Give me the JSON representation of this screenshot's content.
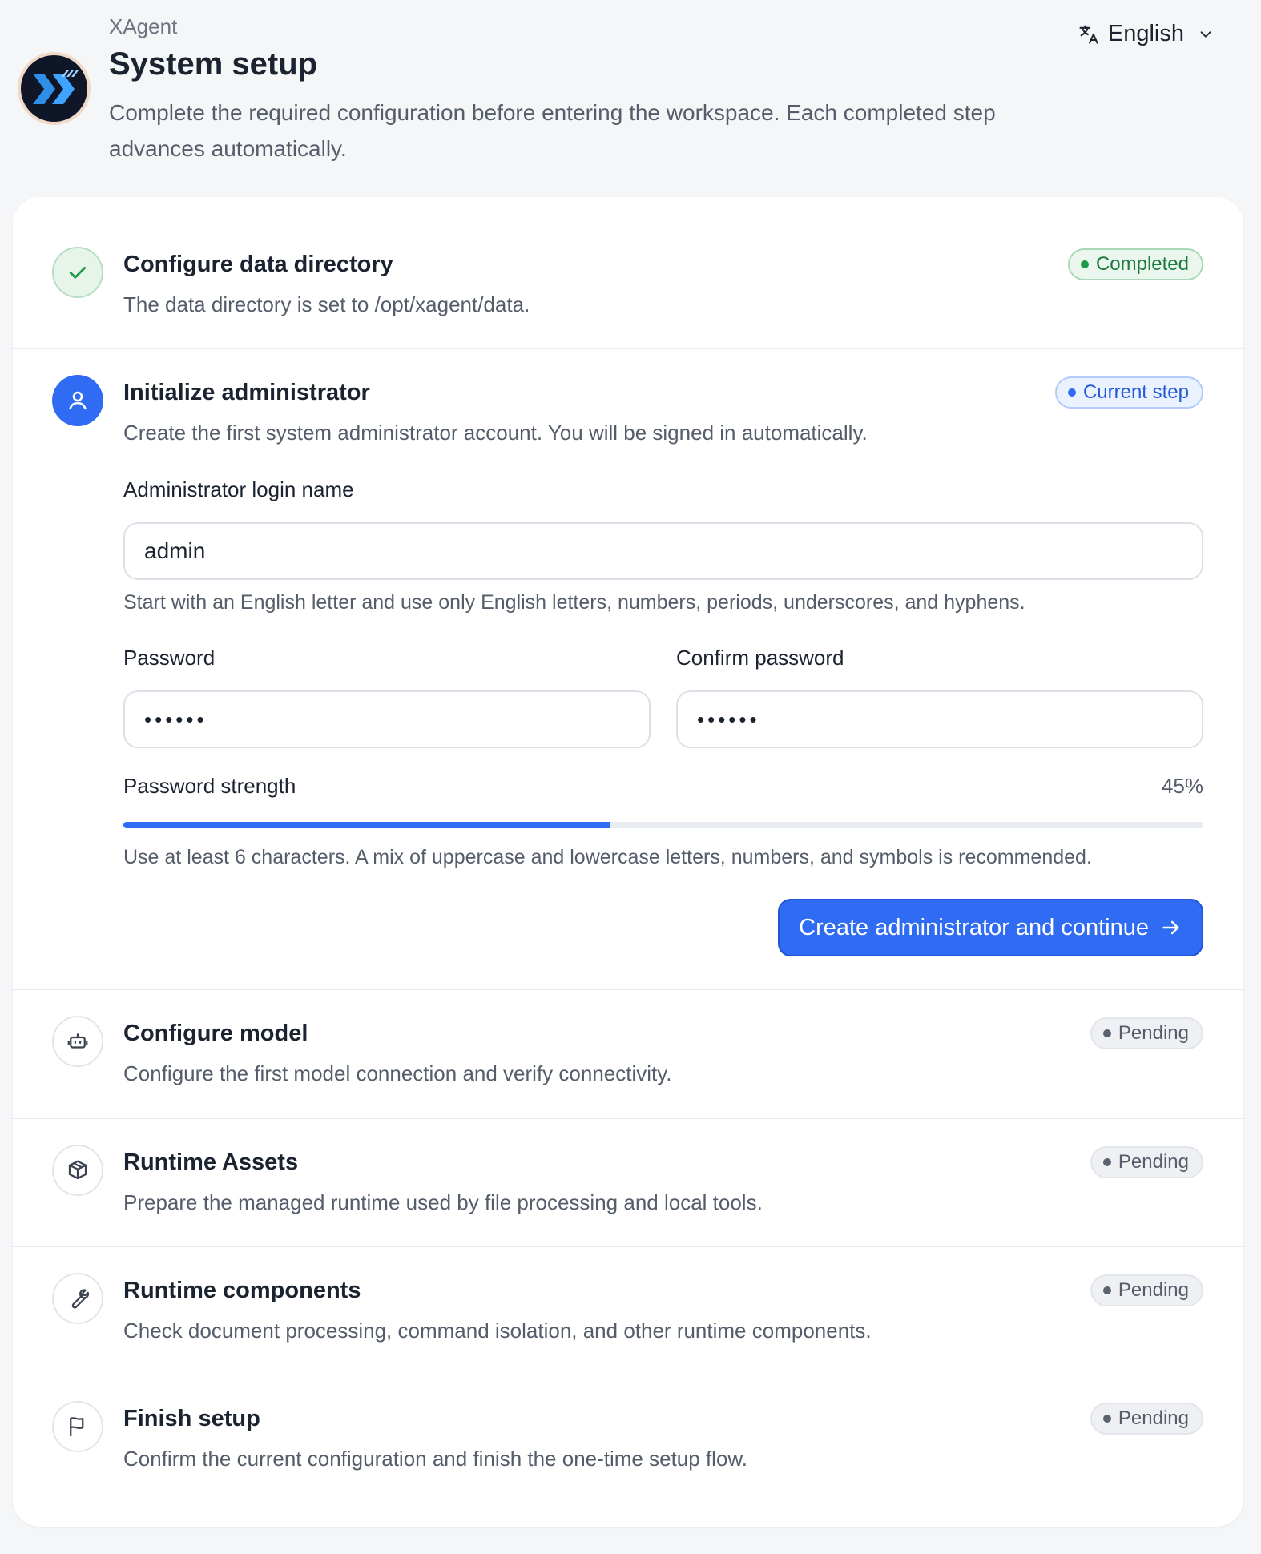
{
  "header": {
    "app_name": "XAgent",
    "title": "System setup",
    "subtitle": "Complete the required configuration before entering the workspace. Each completed step advances automatically.",
    "language": "English",
    "language_icon": "translate-icon",
    "logo_icon": "xagent-logo"
  },
  "steps": [
    {
      "title": "Configure data directory",
      "description": "The data directory is set to /opt/xagent/data.",
      "status": "Completed",
      "icon": "check-icon"
    },
    {
      "title": "Initialize administrator",
      "description": "Create the first system administrator account. You will be signed in automatically.",
      "status": "Current step",
      "icon": "user-icon"
    },
    {
      "title": "Configure model",
      "description": "Configure the first model connection and verify connectivity.",
      "status": "Pending",
      "icon": "robot-icon"
    },
    {
      "title": "Runtime Assets",
      "description": "Prepare the managed runtime used by file processing and local tools.",
      "status": "Pending",
      "icon": "package-icon"
    },
    {
      "title": "Runtime components",
      "description": "Check document processing, command isolation, and other runtime components.",
      "status": "Pending",
      "icon": "wrench-icon"
    },
    {
      "title": "Finish setup",
      "description": "Confirm the current configuration and finish the one-time setup flow.",
      "status": "Pending",
      "icon": "flag-icon"
    }
  ],
  "admin_form": {
    "login_label": "Administrator login name",
    "login_value": "admin",
    "login_hint": "Start with an English letter and use only English letters, numbers, periods, underscores, and hyphens.",
    "password_label": "Password",
    "password_value": "••••••",
    "confirm_label": "Confirm password",
    "confirm_value": "••••••",
    "strength_label": "Password strength",
    "strength_percent": 45,
    "strength_text": "45%",
    "strength_hint": "Use at least 6 characters. A mix of uppercase and lowercase letters, numbers, and symbols is recommended.",
    "submit_label": "Create administrator and continue"
  },
  "colors": {
    "accent": "#2f6cf3",
    "success": "#1c9a4a",
    "pending": "#5b6270",
    "background": "#f5f6f8"
  }
}
